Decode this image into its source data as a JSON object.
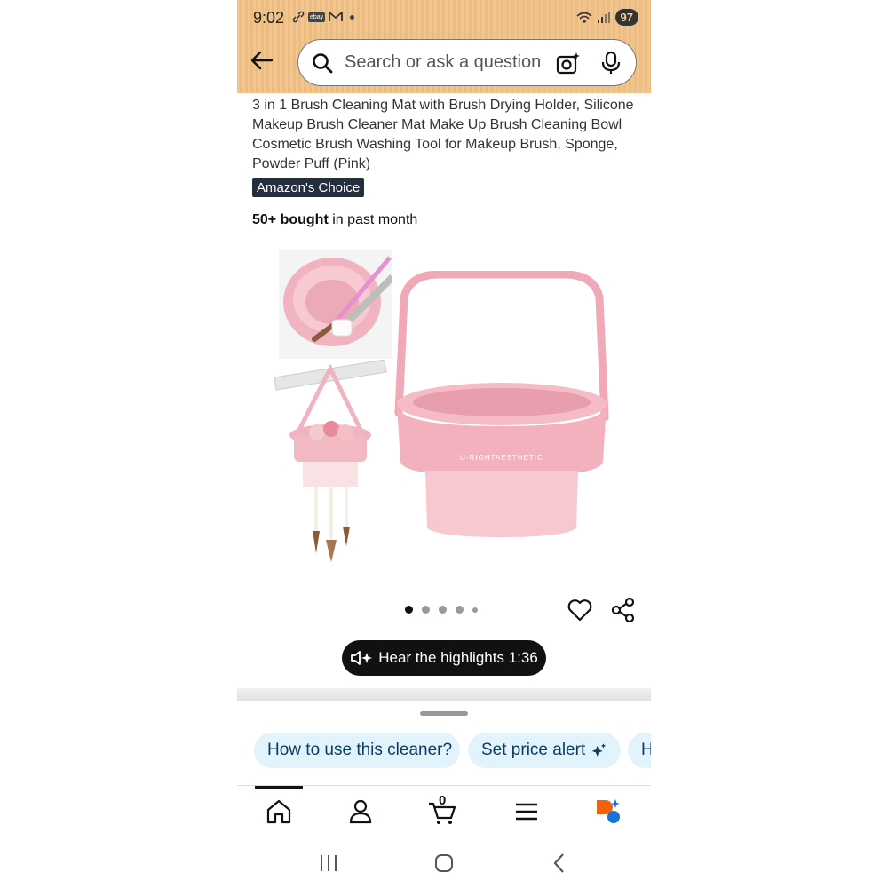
{
  "status_bar": {
    "time": "9:02",
    "battery": "97"
  },
  "search": {
    "placeholder": "Search or ask a question"
  },
  "product": {
    "title": "3 in 1 Brush Cleaning Mat with Brush Drying Holder, Silicone Makeup Brush Cleaner Mat Make Up Brush Cleaning Bowl Cosmetic Brush Washing Tool for Makeup Brush, Sponge, Powder Puff (Pink)",
    "badge": "Amazon's Choice",
    "bought_bold": "50+ bought",
    "bought_rest": " in past month",
    "main_image_brand": "U-RIGHTAESTHETIC"
  },
  "carousel": {
    "total": 5,
    "active_index": 0
  },
  "audio": {
    "label": "Hear the highlights 1:36"
  },
  "suggestions": [
    "How to use this cleaner?",
    "Set price alert",
    "H"
  ],
  "nav": {
    "cart_count": "0"
  },
  "colors": {
    "header": "#f0c58e",
    "chip_bg": "#e3f3fc",
    "chip_text": "#0b3d66",
    "product_pink": "#f2b6c0",
    "badge_bg": "#232f3e"
  }
}
